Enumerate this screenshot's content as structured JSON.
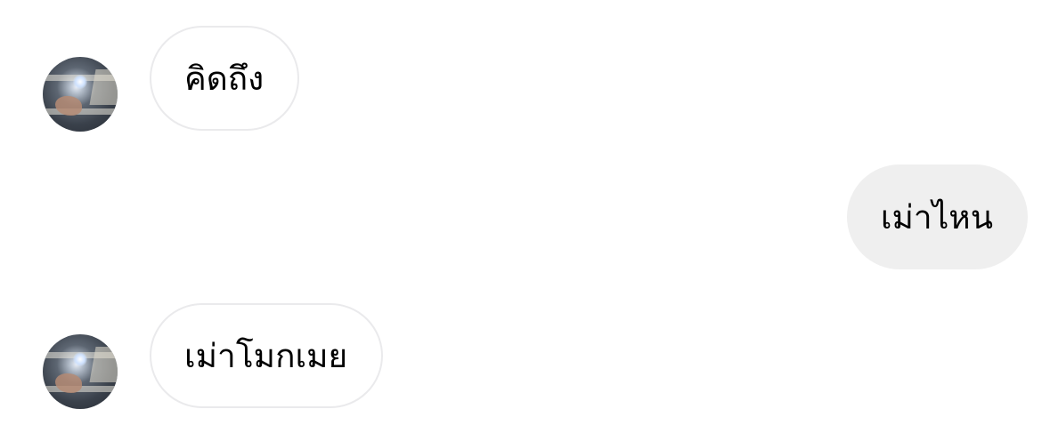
{
  "messages": [
    {
      "direction": "incoming",
      "text": "คิดถึง",
      "show_avatar": true
    },
    {
      "direction": "outgoing",
      "text": "เม่าไหน"
    },
    {
      "direction": "incoming",
      "text": "เม่าโมกเมย",
      "show_avatar": true
    }
  ],
  "colors": {
    "incoming_bubble_border": "#eaeaec",
    "outgoing_bubble_bg": "#efefef",
    "text": "#000000"
  },
  "icons": {
    "avatar": "profile-photo"
  }
}
